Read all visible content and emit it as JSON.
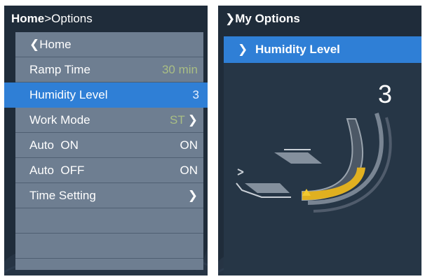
{
  "left_screen": {
    "title_strong": "Home",
    "title_rest": ">Options",
    "menu": [
      {
        "label": "Home",
        "value": "",
        "chevron_left": true
      },
      {
        "label": "Ramp Time",
        "value": "30 min"
      },
      {
        "label": "Humidity Level",
        "value": "3",
        "selected": true
      },
      {
        "label": "Work Mode",
        "value": "ST",
        "chevron_right": true
      },
      {
        "label": "Auto  ON",
        "value": "ON"
      },
      {
        "label": "Auto  OFF",
        "value": "ON"
      },
      {
        "label": "Time Setting",
        "value": "",
        "chevron_right": true
      }
    ]
  },
  "right_screen": {
    "title": "My Options",
    "header": "Humidity Level",
    "level": "3",
    "level_fraction": 0.4
  },
  "colors": {
    "selection_blue": "#2f7fd6",
    "menu_gray": "#6e7e91",
    "gauge_yellow": "#e0b020",
    "dim_value": "#a9be84"
  }
}
